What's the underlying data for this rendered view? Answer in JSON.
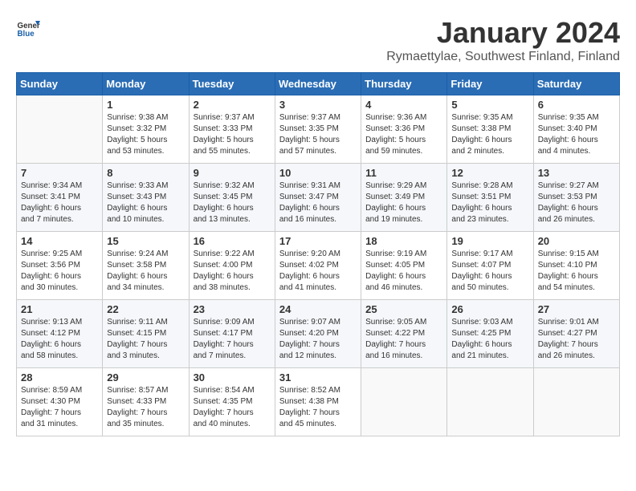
{
  "header": {
    "logo_general": "General",
    "logo_blue": "Blue",
    "month": "January 2024",
    "location": "Rymaettylae, Southwest Finland, Finland"
  },
  "weekdays": [
    "Sunday",
    "Monday",
    "Tuesday",
    "Wednesday",
    "Thursday",
    "Friday",
    "Saturday"
  ],
  "weeks": [
    [
      {
        "day": "",
        "info": ""
      },
      {
        "day": "1",
        "info": "Sunrise: 9:38 AM\nSunset: 3:32 PM\nDaylight: 5 hours\nand 53 minutes."
      },
      {
        "day": "2",
        "info": "Sunrise: 9:37 AM\nSunset: 3:33 PM\nDaylight: 5 hours\nand 55 minutes."
      },
      {
        "day": "3",
        "info": "Sunrise: 9:37 AM\nSunset: 3:35 PM\nDaylight: 5 hours\nand 57 minutes."
      },
      {
        "day": "4",
        "info": "Sunrise: 9:36 AM\nSunset: 3:36 PM\nDaylight: 5 hours\nand 59 minutes."
      },
      {
        "day": "5",
        "info": "Sunrise: 9:35 AM\nSunset: 3:38 PM\nDaylight: 6 hours\nand 2 minutes."
      },
      {
        "day": "6",
        "info": "Sunrise: 9:35 AM\nSunset: 3:40 PM\nDaylight: 6 hours\nand 4 minutes."
      }
    ],
    [
      {
        "day": "7",
        "info": "Sunrise: 9:34 AM\nSunset: 3:41 PM\nDaylight: 6 hours\nand 7 minutes."
      },
      {
        "day": "8",
        "info": "Sunrise: 9:33 AM\nSunset: 3:43 PM\nDaylight: 6 hours\nand 10 minutes."
      },
      {
        "day": "9",
        "info": "Sunrise: 9:32 AM\nSunset: 3:45 PM\nDaylight: 6 hours\nand 13 minutes."
      },
      {
        "day": "10",
        "info": "Sunrise: 9:31 AM\nSunset: 3:47 PM\nDaylight: 6 hours\nand 16 minutes."
      },
      {
        "day": "11",
        "info": "Sunrise: 9:29 AM\nSunset: 3:49 PM\nDaylight: 6 hours\nand 19 minutes."
      },
      {
        "day": "12",
        "info": "Sunrise: 9:28 AM\nSunset: 3:51 PM\nDaylight: 6 hours\nand 23 minutes."
      },
      {
        "day": "13",
        "info": "Sunrise: 9:27 AM\nSunset: 3:53 PM\nDaylight: 6 hours\nand 26 minutes."
      }
    ],
    [
      {
        "day": "14",
        "info": "Sunrise: 9:25 AM\nSunset: 3:56 PM\nDaylight: 6 hours\nand 30 minutes."
      },
      {
        "day": "15",
        "info": "Sunrise: 9:24 AM\nSunset: 3:58 PM\nDaylight: 6 hours\nand 34 minutes."
      },
      {
        "day": "16",
        "info": "Sunrise: 9:22 AM\nSunset: 4:00 PM\nDaylight: 6 hours\nand 38 minutes."
      },
      {
        "day": "17",
        "info": "Sunrise: 9:20 AM\nSunset: 4:02 PM\nDaylight: 6 hours\nand 41 minutes."
      },
      {
        "day": "18",
        "info": "Sunrise: 9:19 AM\nSunset: 4:05 PM\nDaylight: 6 hours\nand 46 minutes."
      },
      {
        "day": "19",
        "info": "Sunrise: 9:17 AM\nSunset: 4:07 PM\nDaylight: 6 hours\nand 50 minutes."
      },
      {
        "day": "20",
        "info": "Sunrise: 9:15 AM\nSunset: 4:10 PM\nDaylight: 6 hours\nand 54 minutes."
      }
    ],
    [
      {
        "day": "21",
        "info": "Sunrise: 9:13 AM\nSunset: 4:12 PM\nDaylight: 6 hours\nand 58 minutes."
      },
      {
        "day": "22",
        "info": "Sunrise: 9:11 AM\nSunset: 4:15 PM\nDaylight: 7 hours\nand 3 minutes."
      },
      {
        "day": "23",
        "info": "Sunrise: 9:09 AM\nSunset: 4:17 PM\nDaylight: 7 hours\nand 7 minutes."
      },
      {
        "day": "24",
        "info": "Sunrise: 9:07 AM\nSunset: 4:20 PM\nDaylight: 7 hours\nand 12 minutes."
      },
      {
        "day": "25",
        "info": "Sunrise: 9:05 AM\nSunset: 4:22 PM\nDaylight: 7 hours\nand 16 minutes."
      },
      {
        "day": "26",
        "info": "Sunrise: 9:03 AM\nSunset: 4:25 PM\nDaylight: 6 hours\nand 21 minutes."
      },
      {
        "day": "27",
        "info": "Sunrise: 9:01 AM\nSunset: 4:27 PM\nDaylight: 7 hours\nand 26 minutes."
      }
    ],
    [
      {
        "day": "28",
        "info": "Sunrise: 8:59 AM\nSunset: 4:30 PM\nDaylight: 7 hours\nand 31 minutes."
      },
      {
        "day": "29",
        "info": "Sunrise: 8:57 AM\nSunset: 4:33 PM\nDaylight: 7 hours\nand 35 minutes."
      },
      {
        "day": "30",
        "info": "Sunrise: 8:54 AM\nSunset: 4:35 PM\nDaylight: 7 hours\nand 40 minutes."
      },
      {
        "day": "31",
        "info": "Sunrise: 8:52 AM\nSunset: 4:38 PM\nDaylight: 7 hours\nand 45 minutes."
      },
      {
        "day": "",
        "info": ""
      },
      {
        "day": "",
        "info": ""
      },
      {
        "day": "",
        "info": ""
      }
    ]
  ]
}
